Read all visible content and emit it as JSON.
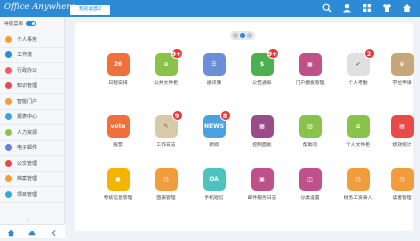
{
  "app": {
    "title": "Office Anywhere",
    "tab_label": "我的桌面2"
  },
  "top_icons": [
    "search-icon",
    "user-icon",
    "apps-icon",
    "shirt-icon",
    "home-icon"
  ],
  "sidebar": {
    "nav_toggle_label": "导航菜单",
    "items": [
      {
        "label": "个人事务",
        "color": "#f39c3c"
      },
      {
        "label": "工作流",
        "color": "#2d8bd6"
      },
      {
        "label": "行政办公",
        "color": "#f06060"
      },
      {
        "label": "知识管理",
        "color": "#e84a4a"
      },
      {
        "label": "智能门户",
        "color": "#f39c3c"
      },
      {
        "label": "报表中心",
        "color": "#35a7e0"
      },
      {
        "label": "人力资源",
        "color": "#8bc34a"
      },
      {
        "label": "电子邮件",
        "color": "#6a7fdb"
      },
      {
        "label": "公文管理",
        "color": "#e84a4a"
      },
      {
        "label": "档案管理",
        "color": "#f39c3c"
      },
      {
        "label": "项目管理",
        "color": "#35a7e0"
      }
    ],
    "collapse_label": "‹"
  },
  "panel": {
    "pages": 3,
    "active_page": 2
  },
  "apps": [
    {
      "label": "日程安排",
      "icon": "calendar-icon",
      "glyph": "26",
      "color": "#f0703a",
      "badge": null
    },
    {
      "label": "公共文件柜",
      "icon": "cabinet-icon",
      "glyph": "≡",
      "color": "#8bc34a",
      "badge": "9+"
    },
    {
      "label": "通讯簿",
      "icon": "addressbook-icon",
      "glyph": "☰",
      "color": "#6a8fd8",
      "badge": null
    },
    {
      "label": "公告通知",
      "icon": "notice-icon",
      "glyph": "$",
      "color": "#4caf50",
      "badge": "9+"
    },
    {
      "label": "门户模板管理",
      "icon": "portal-icon",
      "glyph": "▣",
      "color": "#c0508a",
      "badge": null
    },
    {
      "label": "个人考勤",
      "icon": "attendance-icon",
      "glyph": "✔",
      "color": "#e0e0e0",
      "badge": "2"
    },
    {
      "label": "学位申请",
      "icon": "degree-icon",
      "glyph": "♛",
      "color": "#c7a77a",
      "badge": null
    },
    {
      "label": "投票",
      "icon": "vote-icon",
      "glyph": "vote",
      "color": "#f0703a",
      "badge": null
    },
    {
      "label": "工作日志",
      "icon": "worklog-icon",
      "glyph": "✎",
      "color": "#d8c9a8",
      "badge": "9"
    },
    {
      "label": "新闻",
      "icon": "news-icon",
      "glyph": "NEWS",
      "color": "#4aa3e0",
      "badge": "8"
    },
    {
      "label": "控制面板",
      "icon": "control-panel-icon",
      "glyph": "▦",
      "color": "#9c4b8a",
      "badge": null
    },
    {
      "label": "帮助问",
      "icon": "help-icon",
      "glyph": "▥",
      "color": "#8bc34a",
      "badge": null
    },
    {
      "label": "个人文件柜",
      "icon": "personal-cabinet-icon",
      "glyph": "≡",
      "color": "#8bc34a",
      "badge": null
    },
    {
      "label": "绩效统计",
      "icon": "stats-icon",
      "glyph": "▤",
      "color": "#e84a4a",
      "badge": null
    },
    {
      "label": "考核信息管理",
      "icon": "medal-icon",
      "glyph": "●",
      "color": "#f5b400",
      "badge": null
    },
    {
      "label": "图表管理",
      "icon": "clock-icon",
      "glyph": "◷",
      "color": "#f39c3c",
      "badge": null
    },
    {
      "label": "手机短信",
      "icon": "oa-icon",
      "glyph": "OA",
      "color": "#4dc3c0",
      "badge": null
    },
    {
      "label": "邮件服务日志",
      "icon": "mail-log-icon",
      "glyph": "▣",
      "color": "#c0508a",
      "badge": null
    },
    {
      "label": "分类设置",
      "icon": "category-icon",
      "glyph": "◫",
      "color": "#c0508a",
      "badge": null
    },
    {
      "label": "财务工资录入",
      "icon": "clock2-icon",
      "glyph": "◷",
      "color": "#f39c3c",
      "badge": null
    },
    {
      "label": "读者管理",
      "icon": "clock3-icon",
      "glyph": "◷",
      "color": "#f39c3c",
      "badge": null
    }
  ]
}
